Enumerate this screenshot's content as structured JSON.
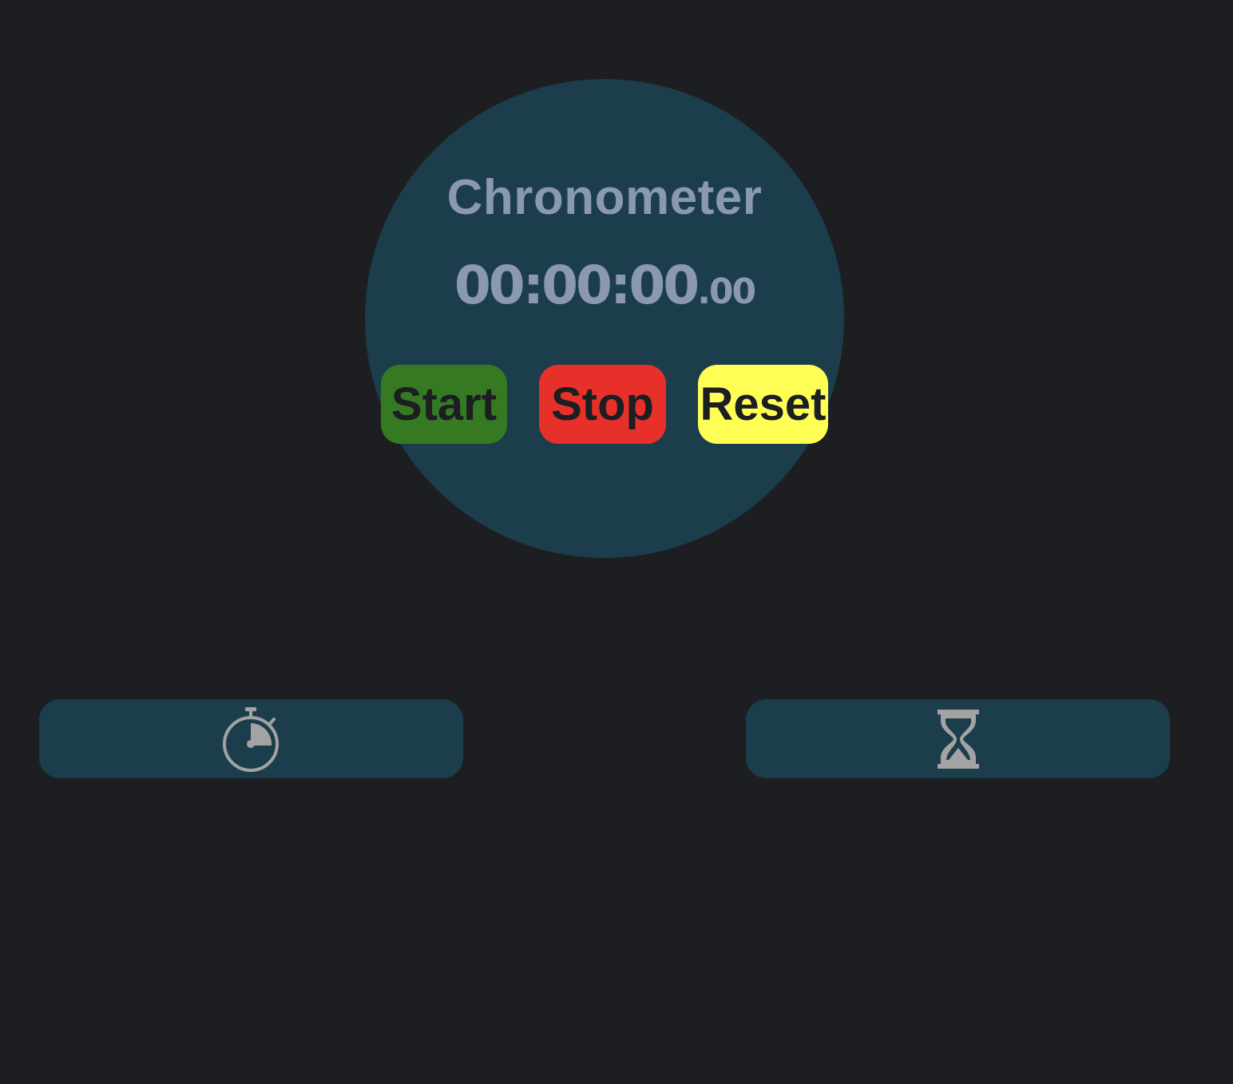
{
  "app": {
    "title": "Chronometer",
    "time": {
      "main": "00:00:00",
      "separator": ".",
      "milliseconds": "00"
    }
  },
  "controls": {
    "start_label": "Start",
    "stop_label": "Stop",
    "reset_label": "Reset"
  },
  "modes": [
    {
      "icon": "stopwatch-icon"
    },
    {
      "icon": "hourglass-icon"
    }
  ],
  "colors": {
    "background": "#1d1e21",
    "panel": "#1c3e4c",
    "text": "#8a98b0",
    "start": "#357a22",
    "stop": "#e7302a",
    "reset": "#fefe54",
    "icon": "#a3a3a3"
  }
}
